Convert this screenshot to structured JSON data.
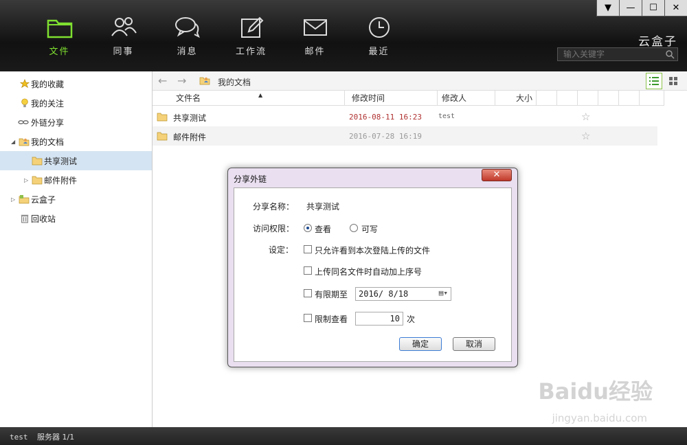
{
  "window": {
    "controls": [
      "▼",
      "—",
      "☐",
      "✕"
    ]
  },
  "nav": [
    {
      "label": "文件",
      "icon": "folder-icon",
      "active": true
    },
    {
      "label": "同事",
      "icon": "people-icon",
      "active": false
    },
    {
      "label": "消息",
      "icon": "chat-icon",
      "active": false
    },
    {
      "label": "工作流",
      "icon": "edit-icon",
      "active": false
    },
    {
      "label": "邮件",
      "icon": "mail-icon",
      "active": false
    },
    {
      "label": "最近",
      "icon": "clock-icon",
      "active": false
    }
  ],
  "brand": "云盒子",
  "search": {
    "placeholder": "输入关键字"
  },
  "sidebar": {
    "items": [
      {
        "label": "我的收藏",
        "icon": "star-icon"
      },
      {
        "label": "我的关注",
        "icon": "bulb-icon"
      },
      {
        "label": "外链分享",
        "icon": "link-icon"
      },
      {
        "label": "我的文档",
        "icon": "user-folder-icon"
      },
      {
        "label": "共享测试",
        "icon": "folder-icon"
      },
      {
        "label": "邮件附件",
        "icon": "folder-icon"
      },
      {
        "label": "云盒子",
        "icon": "cloud-folder-icon"
      },
      {
        "label": "回收站",
        "icon": "trash-icon"
      }
    ]
  },
  "breadcrumb": "我的文档",
  "table": {
    "headers": [
      "文件名",
      "修改时间",
      "修改人",
      "大小"
    ],
    "rows": [
      {
        "name": "共享测试",
        "date": "2016-08-11 16:23",
        "user": "test"
      },
      {
        "name": "邮件附件",
        "date": "2016-07-28 16:19",
        "user": ""
      }
    ]
  },
  "dialog": {
    "title": "分享外链",
    "name_label": "分享名称：",
    "name_value": "共享测试",
    "access_label": "访问权限：",
    "access_view": "查看",
    "access_write": "可写",
    "settings_label": "设定：",
    "opt_only_upload": "只允许看到本次登陆上传的文件",
    "opt_auto_number": "上传同名文件时自动加上序号",
    "opt_expire": "有限期至",
    "expire_date": "2016/ 8/18",
    "opt_limit": "限制查看",
    "limit_count": "10",
    "limit_unit": "次",
    "ok": "确定",
    "cancel": "取消"
  },
  "status": {
    "user": "test",
    "server": "服务器 1/1"
  },
  "watermark": {
    "logo": "Baidu经验",
    "url": "jingyan.baidu.com"
  }
}
